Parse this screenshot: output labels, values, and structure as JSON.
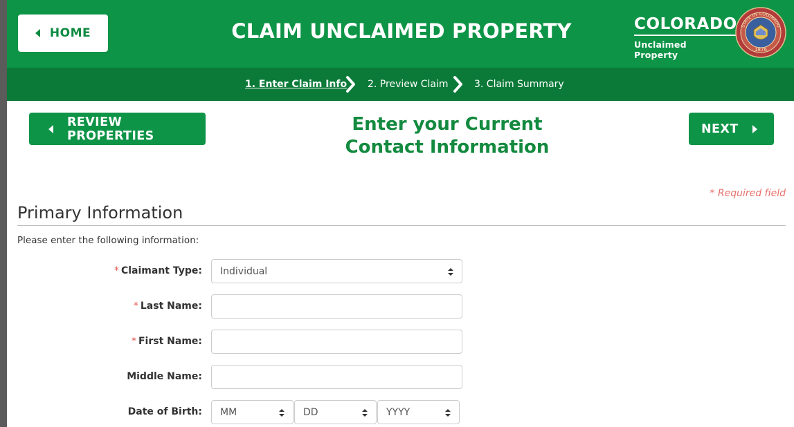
{
  "header": {
    "home_label": "HOME",
    "title": "CLAIM UNCLAIMED PROPERTY",
    "brand_name": "COLORADO",
    "brand_sub": "Unclaimed Property",
    "seal_text": "STATE OF COLORADO",
    "seal_year": "1876",
    "bg_color": "#0e9447"
  },
  "steps": {
    "items": [
      {
        "label": "1. Enter Claim Info",
        "active": true
      },
      {
        "label": "2. Preview Claim",
        "active": false
      },
      {
        "label": "3. Claim Summary",
        "active": false
      }
    ],
    "bg_color": "#0b7a39"
  },
  "actions": {
    "review_label": "REVIEW PROPERTIES",
    "next_label": "NEXT"
  },
  "page": {
    "heading_line1": "Enter your Current",
    "heading_line2": "Contact Information",
    "required_note": "* Required field",
    "section_title": "Primary Information",
    "instructions": "Please enter the following information:"
  },
  "form": {
    "required_marker": "*",
    "claimant_type": {
      "label": "Claimant Type:",
      "value": "Individual",
      "required": true
    },
    "last_name": {
      "label": "Last Name:",
      "value": "",
      "required": true
    },
    "first_name": {
      "label": "First Name:",
      "value": "",
      "required": true
    },
    "middle_name": {
      "label": "Middle Name:",
      "value": "",
      "required": false
    },
    "dob": {
      "label": "Date of Birth:",
      "month": "MM",
      "day": "DD",
      "year": "YYYY",
      "required": false
    }
  }
}
